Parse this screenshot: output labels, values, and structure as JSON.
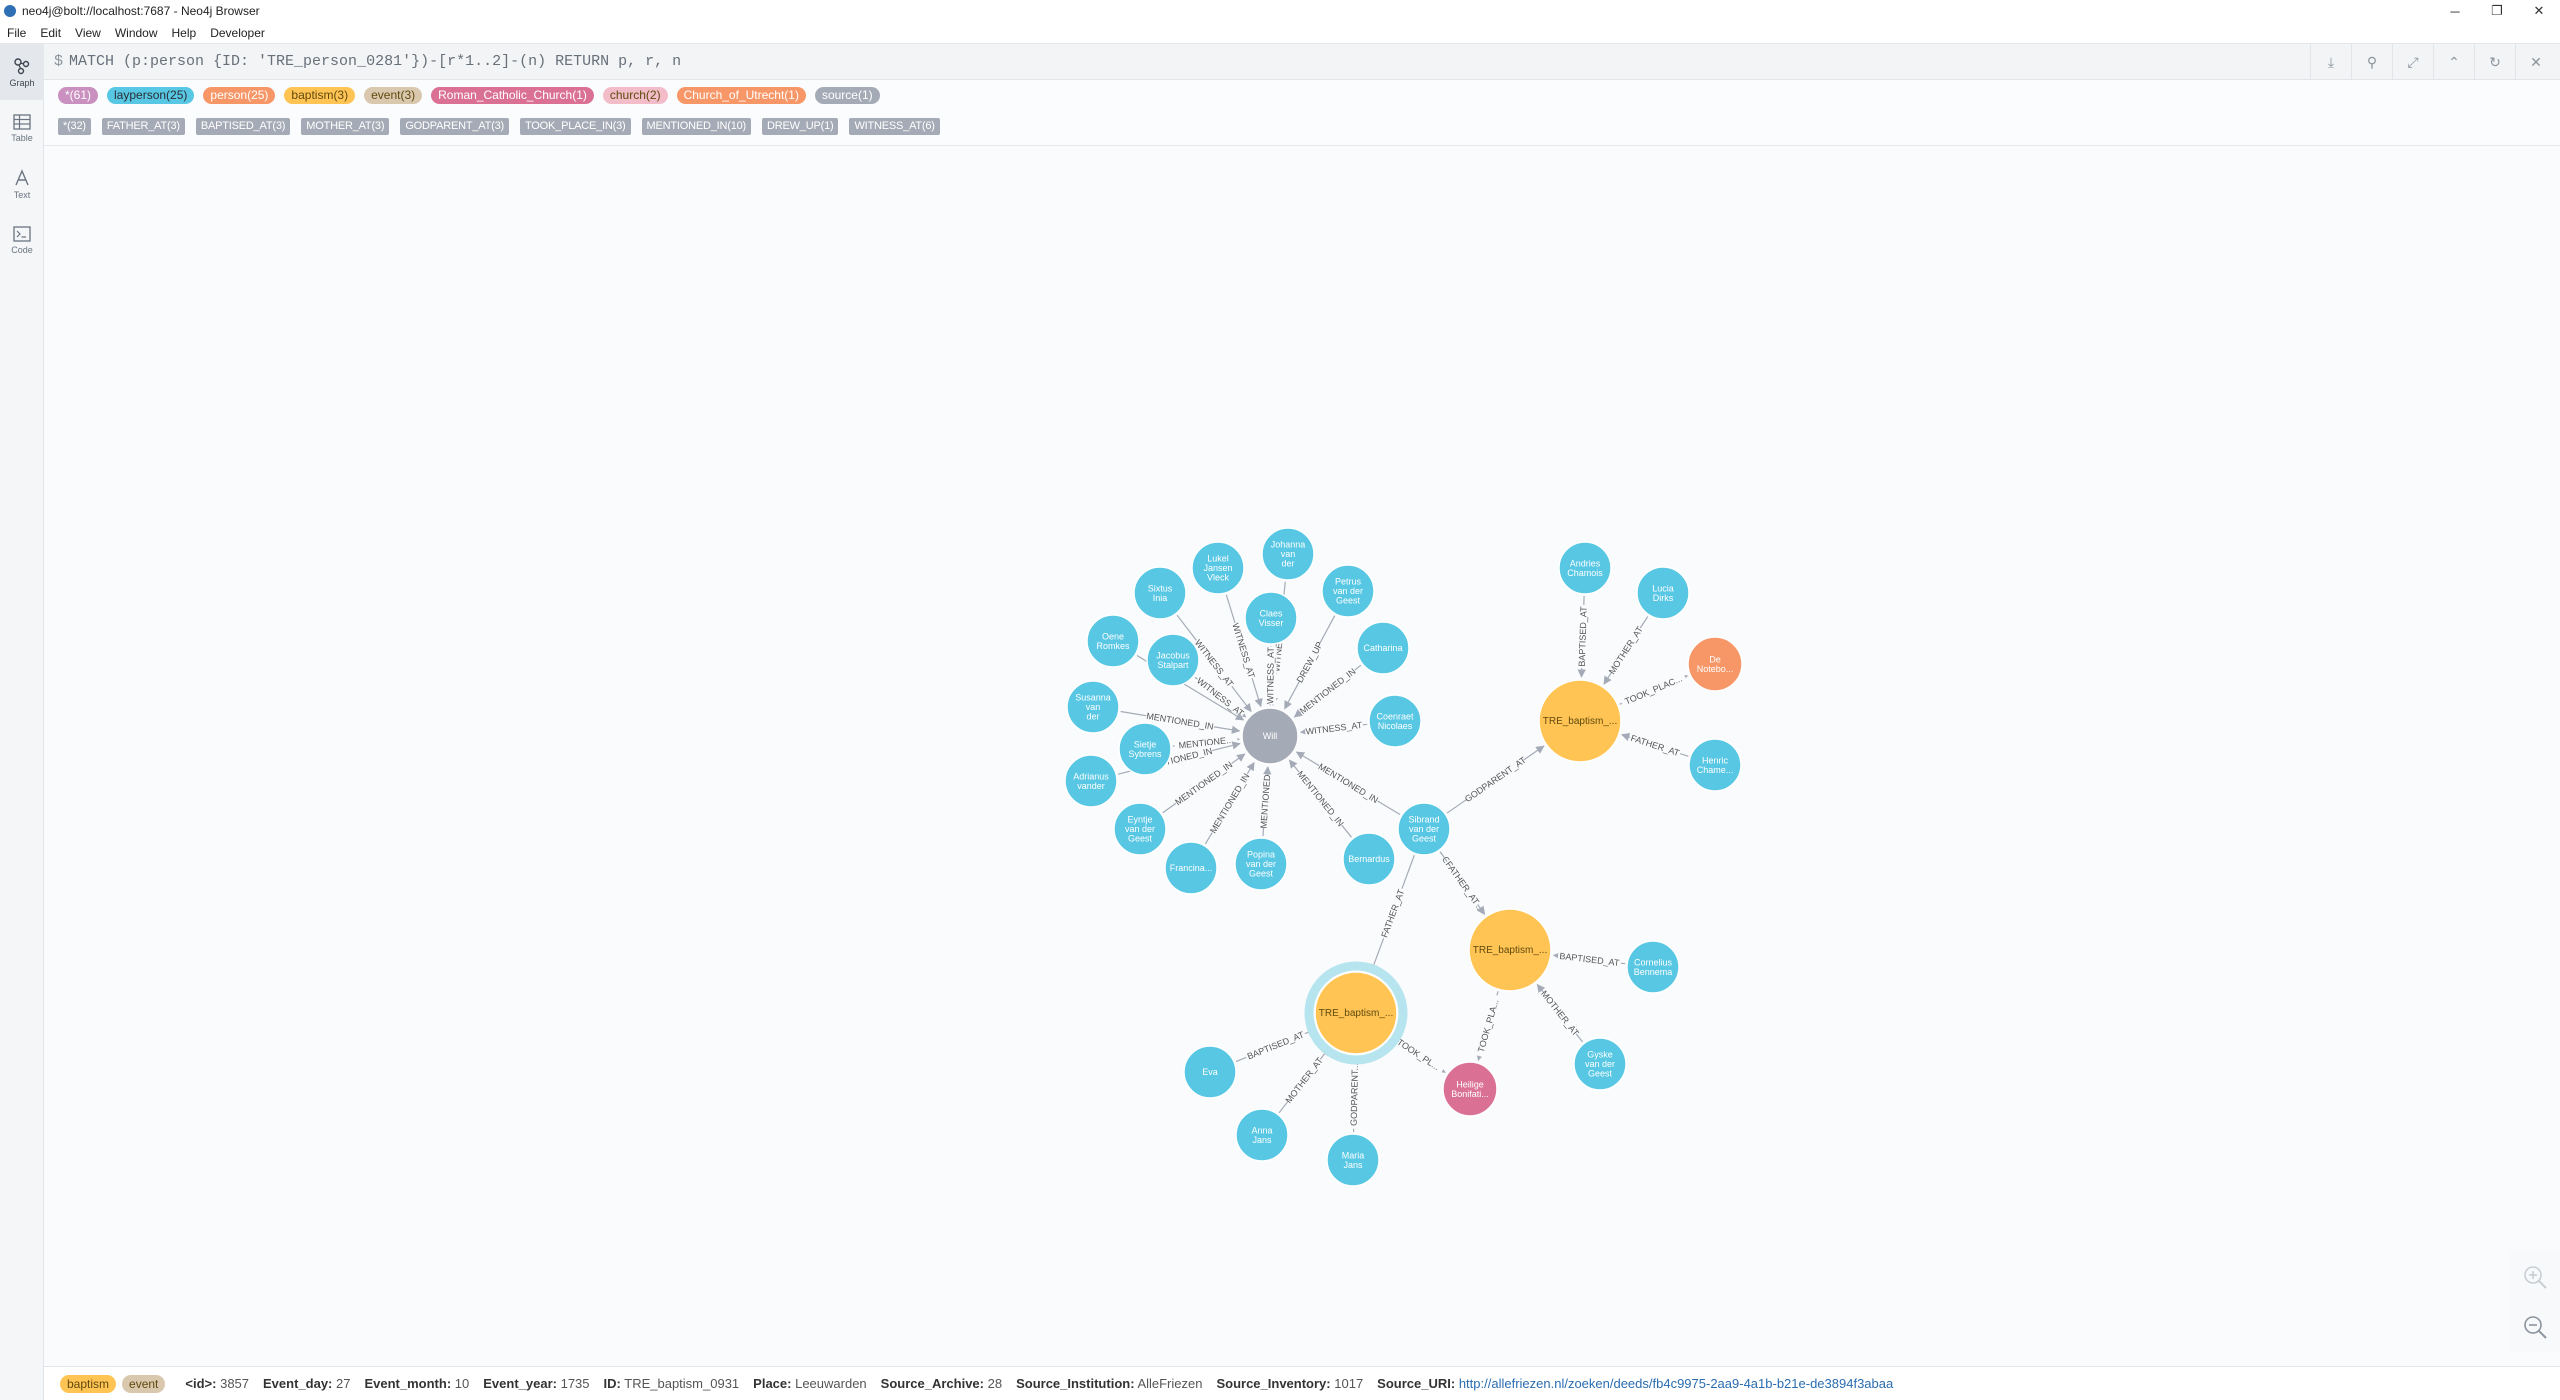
{
  "window": {
    "title": "neo4j@bolt://localhost:7687 - Neo4j Browser",
    "controls": [
      "─",
      "❐",
      "✕"
    ]
  },
  "menu": [
    "File",
    "Edit",
    "View",
    "Window",
    "Help",
    "Developer"
  ],
  "nav": [
    {
      "label": "Graph",
      "icon": "graph-icon",
      "active": true
    },
    {
      "label": "Table",
      "icon": "table-icon",
      "active": false
    },
    {
      "label": "Text",
      "icon": "text-icon",
      "active": false
    },
    {
      "label": "Code",
      "icon": "code-icon",
      "active": false
    }
  ],
  "editor": {
    "prompt": "$",
    "query": "MATCH (p:person {ID: 'TRE_person_0281'})-[r*1..2]-(n) RETURN p, r, n"
  },
  "frame_buttons": [
    "download-icon",
    "pin-icon",
    "expand-icon",
    "collapse-icon",
    "rerun-icon",
    "close-icon"
  ],
  "legend": {
    "labels": [
      {
        "text": "*(61)",
        "bg": "#c990c0",
        "fg": "#ffffff"
      },
      {
        "text": "layperson(25)",
        "bg": "#57c7e3",
        "fg": "#2a2c34"
      },
      {
        "text": "person(25)",
        "bg": "#f79767",
        "fg": "#ffffff"
      },
      {
        "text": "baptism(3)",
        "bg": "#ffc454",
        "fg": "#604a0e"
      },
      {
        "text": "event(3)",
        "bg": "#d9c8ae",
        "fg": "#604a0e"
      },
      {
        "text": "Roman_Catholic_Church(1)",
        "bg": "#da7194",
        "fg": "#ffffff"
      },
      {
        "text": "church(2)",
        "bg": "#f2bcc9",
        "fg": "#604a0e"
      },
      {
        "text": "Church_of_Utrecht(1)",
        "bg": "#f79767",
        "fg": "#ffffff"
      },
      {
        "text": "source(1)",
        "bg": "#a5abb6",
        "fg": "#ffffff"
      }
    ],
    "relationships": [
      "*(32)",
      "FATHER_AT(3)",
      "BAPTISED_AT(3)",
      "MOTHER_AT(3)",
      "GODPARENT_AT(3)",
      "TOOK_PLACE_IN(3)",
      "MENTIONED_IN(10)",
      "DREW_UP(1)",
      "WITNESS_AT(6)"
    ]
  },
  "graph": {
    "nodes": [
      {
        "id": "will",
        "caption": "Will",
        "kind": "source"
      },
      {
        "id": "sibrand",
        "caption": "Sibrand van der Geest",
        "kind": "person"
      },
      {
        "id": "b1",
        "caption": "TRE_baptism_...",
        "kind": "baptism"
      },
      {
        "id": "b2",
        "caption": "TRE_baptism_...",
        "kind": "baptism"
      },
      {
        "id": "b3",
        "caption": "TRE_baptism_...",
        "kind": "baptism",
        "selected": true
      },
      {
        "id": "noteboom",
        "caption": "De Notebo...",
        "kind": "church"
      },
      {
        "id": "heilige",
        "caption": "Heilige Bonifati...",
        "kind": "rcchurch"
      },
      {
        "id": "lukel",
        "caption": "Lukel Jansen Vleck",
        "kind": "person"
      },
      {
        "id": "johanna",
        "caption": "Johanna van der",
        "kind": "person"
      },
      {
        "id": "sixtus",
        "caption": "Sixtus Inia",
        "kind": "person"
      },
      {
        "id": "claes",
        "caption": "Claes Visser",
        "kind": "person"
      },
      {
        "id": "petrus",
        "caption": "Petrus van der Geest",
        "kind": "person"
      },
      {
        "id": "oene",
        "caption": "Oene Romkes",
        "kind": "person"
      },
      {
        "id": "jacobus",
        "caption": "Jacobus Stalpart",
        "kind": "person"
      },
      {
        "id": "catharina",
        "caption": "Catharina",
        "kind": "person"
      },
      {
        "id": "susanna",
        "caption": "Susanna van der",
        "kind": "person"
      },
      {
        "id": "coenraet",
        "caption": "Coenraet Nicolaes",
        "kind": "person"
      },
      {
        "id": "sietje",
        "caption": "Sietje Sybrens",
        "kind": "person"
      },
      {
        "id": "adrianus",
        "caption": "Adrianus vander",
        "kind": "person"
      },
      {
        "id": "eyntje",
        "caption": "Eyntje van der Geest",
        "kind": "person"
      },
      {
        "id": "francina",
        "caption": "Francina...",
        "kind": "person"
      },
      {
        "id": "popina",
        "caption": "Popina van der Geest",
        "kind": "person"
      },
      {
        "id": "bernardus",
        "caption": "Bernardus",
        "kind": "person"
      },
      {
        "id": "andries",
        "caption": "Andries Chamois",
        "kind": "person"
      },
      {
        "id": "lucia",
        "caption": "Lucia Dirks",
        "kind": "person"
      },
      {
        "id": "henric",
        "caption": "Henric Chame...",
        "kind": "person"
      },
      {
        "id": "cornelius",
        "caption": "Cornelius Bennema",
        "kind": "person"
      },
      {
        "id": "gyske",
        "caption": "Gyske van der Geest",
        "kind": "person"
      },
      {
        "id": "eva",
        "caption": "Eva",
        "kind": "person"
      },
      {
        "id": "anna",
        "caption": "Anna Jans",
        "kind": "person"
      },
      {
        "id": "maria",
        "caption": "Maria Jans",
        "kind": "person"
      }
    ],
    "edges": [
      {
        "from": "lukel",
        "to": "will",
        "label": "WITNESS_AT"
      },
      {
        "from": "johanna",
        "to": "will",
        "label": "WITNESS_AT"
      },
      {
        "from": "claes",
        "to": "will",
        "label": "WITNESS_AT"
      },
      {
        "from": "petrus",
        "to": "will",
        "label": "DREW_UP"
      },
      {
        "from": "catharina",
        "to": "will",
        "label": "MENTIONED_IN"
      },
      {
        "from": "coenraet",
        "to": "will",
        "label": "WITNESS_AT"
      },
      {
        "from": "sixtus",
        "to": "will",
        "label": "WITNESS_AT"
      },
      {
        "from": "jacobus",
        "to": "will",
        "label": "WITNESS_AT"
      },
      {
        "from": "oene",
        "to": "will",
        "label": ""
      },
      {
        "from": "susanna",
        "to": "will",
        "label": "MENTIONED_IN"
      },
      {
        "from": "sietje",
        "to": "will",
        "label": "MENTIONE..."
      },
      {
        "from": "adrianus",
        "to": "will",
        "label": "MENTIONED_IN"
      },
      {
        "from": "eyntje",
        "to": "will",
        "label": "MENTIONED_IN"
      },
      {
        "from": "francina",
        "to": "will",
        "label": "MENTIONED_IN"
      },
      {
        "from": "popina",
        "to": "will",
        "label": "MENTIONED"
      },
      {
        "from": "bernardus",
        "to": "will",
        "label": "MENTIONED_IN"
      },
      {
        "from": "sibrand",
        "to": "will",
        "label": "MENTIONED_IN"
      },
      {
        "from": "sibrand",
        "to": "b1",
        "label": "GODPARENT_AT"
      },
      {
        "from": "sibrand",
        "to": "b2",
        "label": "GODPARENT..."
      },
      {
        "from": "sibrand",
        "to": "b3",
        "label": "FATHER_AT"
      },
      {
        "from": "sibrand",
        "to": "b2",
        "label": "FATHER_AT"
      },
      {
        "from": "andries",
        "to": "b1",
        "label": "BAPTISED_AT"
      },
      {
        "from": "lucia",
        "to": "b1",
        "label": "MOTHER_AT"
      },
      {
        "from": "b1",
        "to": "noteboom",
        "label": "TOOK_PLAC..."
      },
      {
        "from": "henric",
        "to": "b1",
        "label": "FATHER_AT"
      },
      {
        "from": "cornelius",
        "to": "b2",
        "label": "BAPTISED_AT"
      },
      {
        "from": "gyske",
        "to": "b2",
        "label": "MOTHER_AT"
      },
      {
        "from": "b2",
        "to": "heilige",
        "label": "TOOK_PLA..."
      },
      {
        "from": "b3",
        "to": "heilige",
        "label": "TOOK_PL..."
      },
      {
        "from": "eva",
        "to": "b3",
        "label": "BAPTISED_AT"
      },
      {
        "from": "anna",
        "to": "b3",
        "label": "MOTHER_AT"
      },
      {
        "from": "maria",
        "to": "b3",
        "label": "GODPARENT..."
      }
    ]
  },
  "status": {
    "badges": [
      {
        "text": "baptism",
        "bg": "#ffc454",
        "fg": "#604a0e"
      },
      {
        "text": "event",
        "bg": "#d9c8ae",
        "fg": "#604a0e"
      }
    ],
    "properties": [
      {
        "key": "<id>:",
        "value": "3857"
      },
      {
        "key": "Event_day:",
        "value": "27"
      },
      {
        "key": "Event_month:",
        "value": "10"
      },
      {
        "key": "Event_year:",
        "value": "1735"
      },
      {
        "key": "ID:",
        "value": "TRE_baptism_0931"
      },
      {
        "key": "Place:",
        "value": "Leeuwarden"
      },
      {
        "key": "Source_Archive:",
        "value": "28"
      },
      {
        "key": "Source_Institution:",
        "value": "AlleFriezen"
      },
      {
        "key": "Source_Inventory:",
        "value": "1017"
      },
      {
        "key": "Source_URI:",
        "value": "http://allefriezen.nl/zoeken/deeds/fb4c9975-2aa9-4a1b-b21e-de3894f3abaa",
        "link": true
      }
    ]
  },
  "colors": {
    "person": "#57c7e3",
    "baptism": "#ffc454",
    "source": "#a5abb6",
    "church": "#f79767",
    "rcchurch": "#da7194",
    "edge": "#a5abb6"
  }
}
